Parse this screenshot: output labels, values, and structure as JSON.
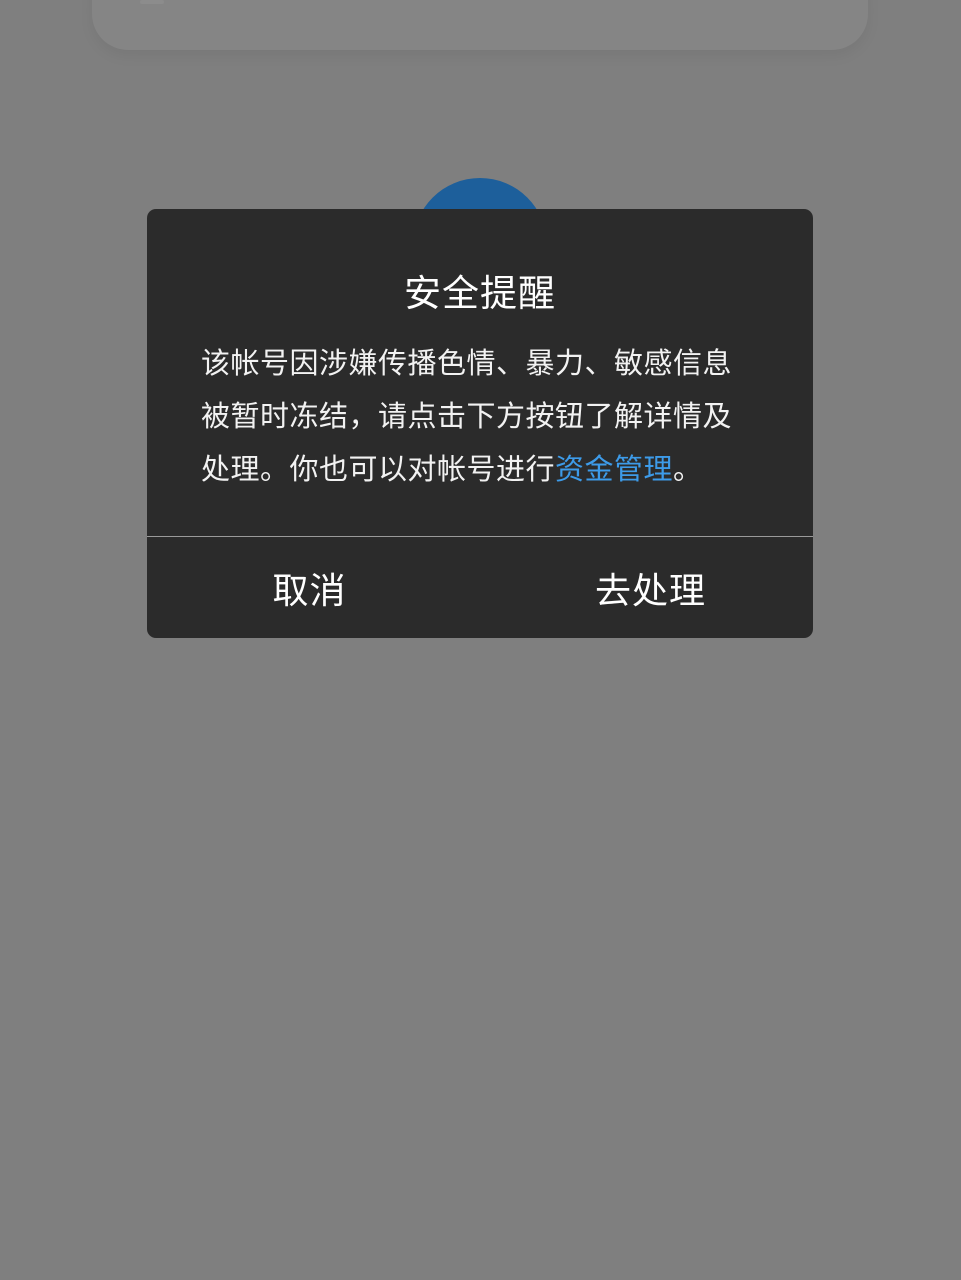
{
  "dialog": {
    "title": "安全提醒",
    "body": {
      "line1": "该帐号因涉嫌传播色情、暴力、敏感信息",
      "line2": "被暂时冻结，请点击下方按钮了解详情及",
      "line3_prefix": "处理。你也可以对帐号进行",
      "link": "资金管理",
      "line3_suffix": "。"
    },
    "cancel_label": "取消",
    "confirm_label": "去处理"
  },
  "colors": {
    "overlay": "#7f7f7f",
    "dialog_bg": "#2b2b2b",
    "link": "#3d9be9",
    "avatar": "#1d5f9b"
  }
}
